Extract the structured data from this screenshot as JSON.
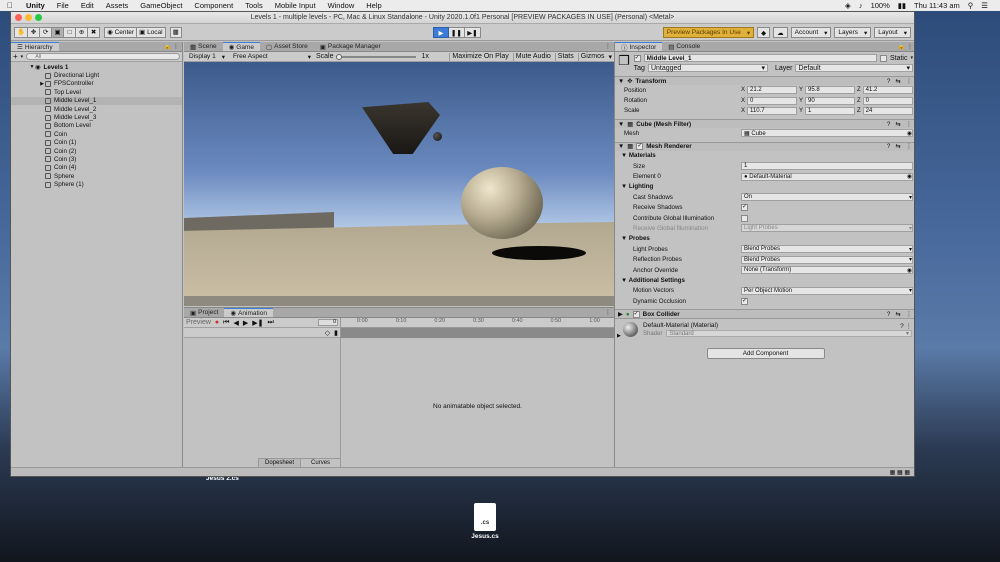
{
  "menubar": {
    "app": "Unity",
    "items": [
      "File",
      "Edit",
      "Assets",
      "GameObject",
      "Component",
      "Tools",
      "Mobile Input",
      "Window",
      "Help"
    ],
    "battery": "100%",
    "clock": "Thu 11:43 am"
  },
  "window": {
    "title": "Levels 1 - multiple levels - PC, Mac & Linux Standalone - Unity 2020.1.0f1 Personal [PREVIEW PACKAGES IN USE] (Personal) <Metal>"
  },
  "toolbar": {
    "pivot": "Center",
    "space": "Local",
    "preview_packages": "Preview Packages In Use",
    "account": "Account",
    "layers": "Layers",
    "layout": "Layout"
  },
  "hierarchy": {
    "tab": "Hierarchy",
    "search_placeholder": "All",
    "scene": "Levels 1",
    "items": [
      {
        "label": "Directional Light",
        "indent": 2,
        "selected": false,
        "arrow": ""
      },
      {
        "label": "FPSController",
        "indent": 2,
        "selected": false,
        "arrow": "▶"
      },
      {
        "label": "Top Level",
        "indent": 2,
        "selected": false,
        "arrow": ""
      },
      {
        "label": "Middle Level_1",
        "indent": 2,
        "selected": true,
        "arrow": ""
      },
      {
        "label": "Middle Level_2",
        "indent": 2,
        "selected": false,
        "arrow": ""
      },
      {
        "label": "Middle Level_3",
        "indent": 2,
        "selected": false,
        "arrow": ""
      },
      {
        "label": "Bottom Level",
        "indent": 2,
        "selected": false,
        "arrow": ""
      },
      {
        "label": "Coin",
        "indent": 2,
        "selected": false,
        "arrow": ""
      },
      {
        "label": "Coin (1)",
        "indent": 2,
        "selected": false,
        "arrow": ""
      },
      {
        "label": "Coin (2)",
        "indent": 2,
        "selected": false,
        "arrow": ""
      },
      {
        "label": "Coin (3)",
        "indent": 2,
        "selected": false,
        "arrow": ""
      },
      {
        "label": "Coin (4)",
        "indent": 2,
        "selected": false,
        "arrow": ""
      },
      {
        "label": "Sphere",
        "indent": 2,
        "selected": false,
        "arrow": ""
      },
      {
        "label": "Sphere (1)",
        "indent": 2,
        "selected": false,
        "arrow": ""
      }
    ]
  },
  "game": {
    "tabs": [
      "Scene",
      "Game",
      "Asset Store",
      "Package Manager"
    ],
    "display": "Display 1",
    "aspect": "Free Aspect",
    "scale_label": "Scale",
    "scale_value": "1x",
    "options": [
      "Maximize On Play",
      "Mute Audio",
      "Stats",
      "Gizmos"
    ]
  },
  "animation": {
    "tabs": [
      "Project",
      "Animation"
    ],
    "preview": "Preview",
    "frame": "0",
    "ticks": [
      "0:00",
      "0:10",
      "0:20",
      "0:30",
      "0:40",
      "0:50",
      "1:00"
    ],
    "empty_message": "No animatable object selected.",
    "bottom_tabs": [
      "Dopesheet",
      "Curves"
    ]
  },
  "inspector": {
    "tabs": [
      "Inspector",
      "Console"
    ],
    "object_name": "Middle Level_1",
    "static_label": "Static",
    "tag_label": "Tag",
    "tag_value": "Untagged",
    "layer_label": "Layer",
    "layer_value": "Default",
    "transform": {
      "title": "Transform",
      "position": {
        "label": "Position",
        "x": "21.2",
        "y": "95.8",
        "z": "41.2"
      },
      "rotation": {
        "label": "Rotation",
        "x": "0",
        "y": "90",
        "z": "0"
      },
      "scale": {
        "label": "Scale",
        "x": "110.7",
        "y": "1",
        "z": "24"
      }
    },
    "mesh_filter": {
      "title": "Cube (Mesh Filter)",
      "mesh_label": "Mesh",
      "mesh_value": "Cube"
    },
    "mesh_renderer": {
      "title": "Mesh Renderer",
      "materials": "Materials",
      "size_label": "Size",
      "size_value": "1",
      "element_label": "Element 0",
      "element_value": "Default-Material",
      "lighting": "Lighting",
      "cast_shadows_label": "Cast Shadows",
      "cast_shadows_value": "On",
      "receive_shadows_label": "Receive Shadows",
      "contribute_gi_label": "Contribute Global Illumination",
      "receive_gi_label": "Receive Global Illumination",
      "receive_gi_value": "Light Probes",
      "probes": "Probes",
      "light_probes_label": "Light Probes",
      "light_probes_value": "Blend Probes",
      "reflection_probes_label": "Reflection Probes",
      "reflection_probes_value": "Blend Probes",
      "anchor_label": "Anchor Override",
      "anchor_value": "None (Transform)",
      "additional": "Additional Settings",
      "motion_label": "Motion Vectors",
      "motion_value": "Per Object Motion",
      "occlusion_label": "Dynamic Occlusion"
    },
    "box_collider": {
      "title": "Box Collider"
    },
    "material": {
      "title": "Default-Material (Material)",
      "shader_label": "Shader",
      "shader_value": "Standard"
    },
    "add_component": "Add Component"
  },
  "desktop": {
    "file_top": "Jesus 2.cs",
    "file_icon_label": ".cs",
    "file_name": "Jesus.cs"
  }
}
